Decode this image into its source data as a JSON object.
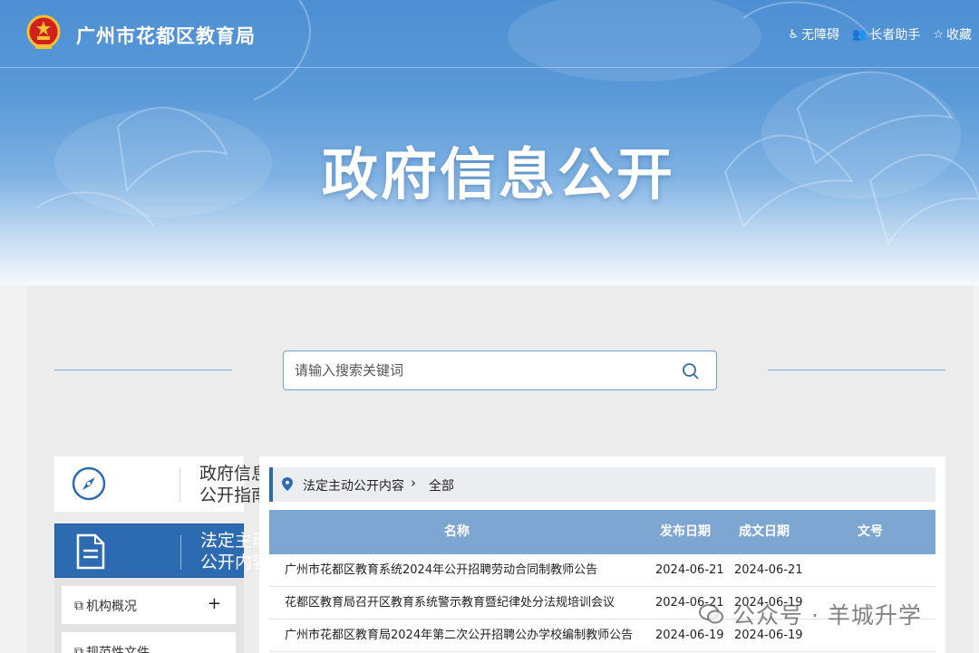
{
  "header": {
    "site_title": "广州市花都区教育局",
    "links": [
      {
        "icon": "wheelchair-icon",
        "label": "无障碍"
      },
      {
        "icon": "elder-icon",
        "label": "长者助手"
      },
      {
        "icon": "star-icon",
        "label": "收藏"
      }
    ],
    "hero_title": "政府信息公开"
  },
  "search": {
    "placeholder": "请输入搜索关键词"
  },
  "sidebar": {
    "guide": "政府信息公开指南",
    "active": "法定主动公开内容",
    "items": [
      {
        "label": "机构概况",
        "expand": "+"
      },
      {
        "label": "规范性文件"
      }
    ]
  },
  "breadcrumb": {
    "level1": "法定主动公开内容",
    "separator": "›",
    "level2": "全部"
  },
  "table": {
    "headers": [
      "名称",
      "发布日期",
      "成文日期",
      "文号"
    ],
    "rows": [
      {
        "name": "广州市花都区教育系统2024年公开招聘劳动合同制教师公告",
        "published": "2024-06-21",
        "written": "2024-06-21",
        "number": ""
      },
      {
        "name": "花都区教育局召开区教育系统警示教育暨纪律处分法规培训会议",
        "published": "2024-06-21",
        "written": "2024-06-19",
        "number": ""
      },
      {
        "name": "广州市花都区教育局2024年第二次公开招聘公办学校编制教师公告",
        "published": "2024-06-19",
        "written": "2024-06-19",
        "number": ""
      }
    ]
  },
  "watermark": "公众号 · 羊城升学",
  "colors": {
    "primary": "#2c6ab1",
    "table_header": "#7ea6d3",
    "banner": "#5b9ad8"
  }
}
